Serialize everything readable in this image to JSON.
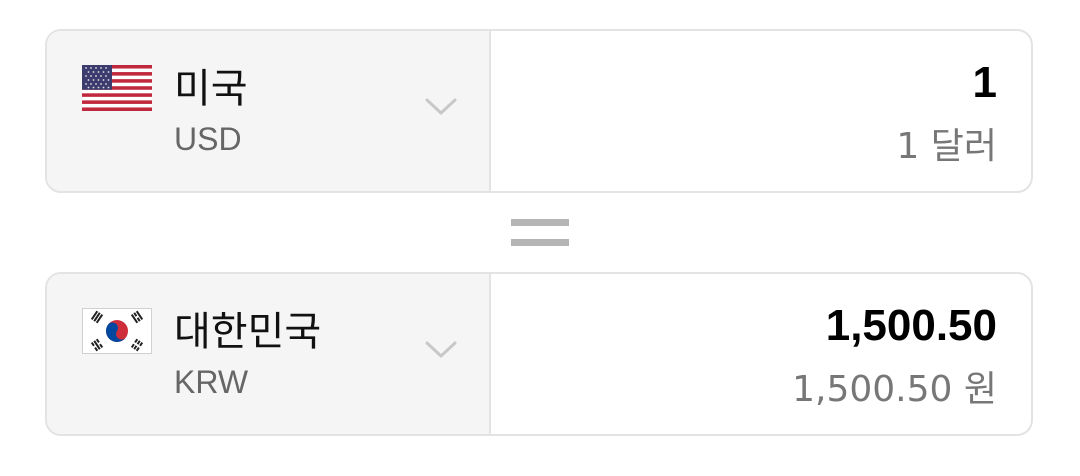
{
  "from": {
    "country": "미국",
    "code": "USD",
    "amount": "1",
    "amount_words": "1 달러",
    "flag_icon": "us-flag"
  },
  "to": {
    "country": "대한민국",
    "code": "KRW",
    "amount": "1,500.50",
    "amount_words": "1,500.50 원",
    "flag_icon": "kr-flag"
  },
  "equals_icon": "equals-icon",
  "colors": {
    "selector_bg": "#f5f5f5",
    "border": "#e3e3e3",
    "secondary_text": "#777777",
    "equals": "#b5b5b5"
  }
}
